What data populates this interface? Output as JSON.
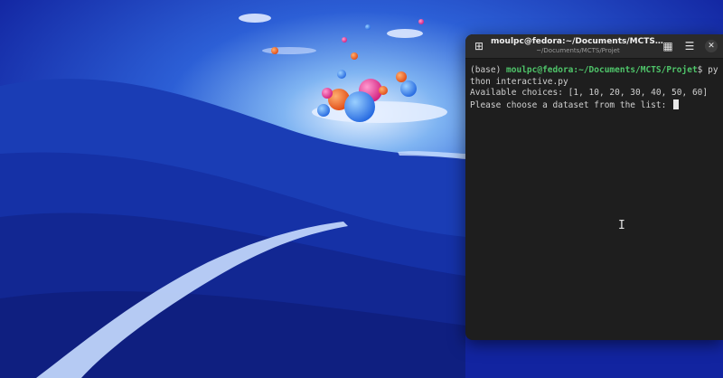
{
  "terminal": {
    "title": "moulpc@fedora:~/Documents/MCTS/Projet",
    "subtitle": "~/Documents/MCTS/Projet",
    "new_tab_icon": "new-tab-icon",
    "view_icon": "grid-view-icon",
    "menu_icon": "hamburger-menu-icon",
    "close_icon": "close-icon",
    "prompt_env": "(base) ",
    "prompt_user": "moulpc@fedora:~/Documents/MCTS/Projet",
    "prompt_symbol": "$ ",
    "command": "python interactive.py",
    "line2": "Available choices: [1, 10, 20, 30, 40, 50, 60]",
    "line3": "Please choose a dataset from the list: "
  },
  "colors": {
    "desktop_bg": "#0c1a7a",
    "terminal_bg": "#1e1e1e",
    "prompt_green": "#4fc56a"
  }
}
